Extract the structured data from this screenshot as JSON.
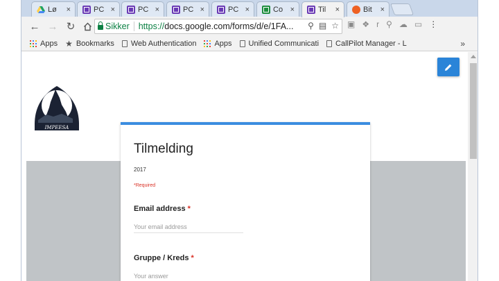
{
  "browser": {
    "tabs": [
      {
        "label": "Lø",
        "icon": "google-drive-icon",
        "active": false
      },
      {
        "label": "PC",
        "icon": "google-forms-icon",
        "active": false
      },
      {
        "label": "PC",
        "icon": "google-forms-icon",
        "active": false
      },
      {
        "label": "PC",
        "icon": "google-forms-icon",
        "active": false
      },
      {
        "label": "PC",
        "icon": "google-forms-icon",
        "active": false
      },
      {
        "label": "Co",
        "icon": "google-sheets-icon",
        "active": false
      },
      {
        "label": "Til",
        "icon": "google-forms-icon",
        "active": true
      },
      {
        "label": "Bit",
        "icon": "bitly-icon",
        "active": false
      }
    ],
    "tab_close": "×",
    "security_label": "Sikker",
    "url_scheme": "https://",
    "url_rest": "docs.google.com/forms/d/e/1FA...",
    "bookmarks": [
      {
        "label": "Apps",
        "icon": "apps-grid-icon"
      },
      {
        "label": "Bookmarks",
        "icon": "star-icon"
      },
      {
        "label": "Web Authentication",
        "icon": "page-icon"
      },
      {
        "label": "Apps",
        "icon": "apps-grid-icon"
      },
      {
        "label": "Unified Communicati",
        "icon": "page-icon"
      },
      {
        "label": "CallPilot Manager - L",
        "icon": "page-icon"
      }
    ],
    "bookmarks_overflow": "»"
  },
  "form": {
    "title": "Tilmelding",
    "description": "2017",
    "required_note": "*Required",
    "questions": [
      {
        "label": "Email address",
        "required_mark": "*",
        "placeholder": "Your email address"
      },
      {
        "label": "Gruppe / Kreds",
        "required_mark": "*",
        "placeholder": "Your answer"
      }
    ]
  },
  "logo": {
    "text": "IMPEESA"
  },
  "colors": {
    "accent": "#3b8de0",
    "edit_button": "#2a84d8",
    "required": "#d93025",
    "secure": "#0b8043",
    "background_gray": "#c0c4c7"
  }
}
